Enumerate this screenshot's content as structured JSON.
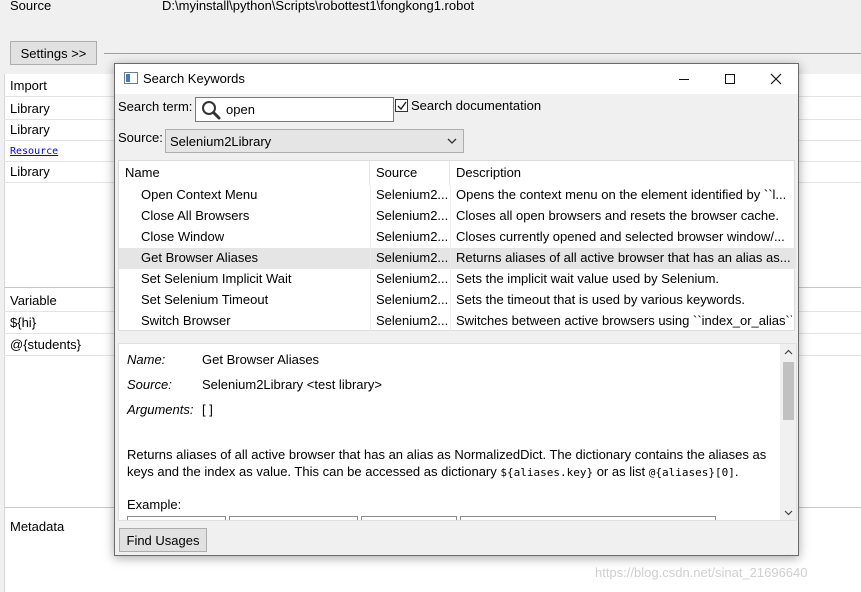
{
  "editor": {
    "source_label": "Source",
    "source_path": "D:\\myinstall\\python\\Scripts\\robottest1\\fongkong1.robot",
    "settings_button": "Settings >>",
    "rows": {
      "import_header": "Import",
      "library1": "Library",
      "library2": "Library",
      "resource": "Resource",
      "library3": "Library",
      "variable_header": "Variable",
      "var1": "${hi}",
      "var2": "@{students}",
      "metadata_header": "Metadata"
    },
    "watermark": "https://blog.csdn.net/sinat_21696640"
  },
  "dialog": {
    "title": "Search Keywords",
    "search_term_label": "Search term:",
    "search_value": "open",
    "search_doc_label": "Search documentation",
    "search_doc_checked": true,
    "source_label": "Source:",
    "source_value": "Selenium2Library",
    "columns": [
      "Name",
      "Source",
      "Description"
    ],
    "rows": [
      {
        "name": "Open Context Menu",
        "source": "Selenium2...",
        "desc": "Opens the context menu on the element identified by ``l..."
      },
      {
        "name": "Close All Browsers",
        "source": "Selenium2...",
        "desc": "Closes all open browsers and resets the browser cache."
      },
      {
        "name": "Close Window",
        "source": "Selenium2...",
        "desc": "Closes currently opened and selected browser window/..."
      },
      {
        "name": "Get Browser Aliases",
        "source": "Selenium2...",
        "desc": "Returns aliases of all active browser that has an alias as..."
      },
      {
        "name": "Set Selenium Implicit Wait",
        "source": "Selenium2...",
        "desc": "Sets the implicit wait value used by Selenium."
      },
      {
        "name": "Set Selenium Timeout",
        "source": "Selenium2...",
        "desc": "Sets the timeout that is used by various keywords."
      },
      {
        "name": "Switch Browser",
        "source": "Selenium2...",
        "desc": "Switches between active browsers using ``index_or_alias``."
      }
    ],
    "selected_row_index": 3,
    "details": {
      "name_label": "Name:",
      "name_value": "Get Browser Aliases",
      "source_label": "Source:",
      "source_value": "Selenium2Library <test library>",
      "arguments_label": "Arguments:",
      "arguments_value": "[ ]",
      "para_1": "Returns aliases of all active browser that has an alias as NormalizedDict. The dictionary contains the aliases as keys and the index as value. This can be accessed as dictionary ",
      "code_1": "${aliases.key}",
      "para_2": " or as list ",
      "code_2": "@{aliases}[0]",
      "para_3": ".",
      "example_label": "Example:"
    },
    "find_usages_label": "Find Usages"
  }
}
